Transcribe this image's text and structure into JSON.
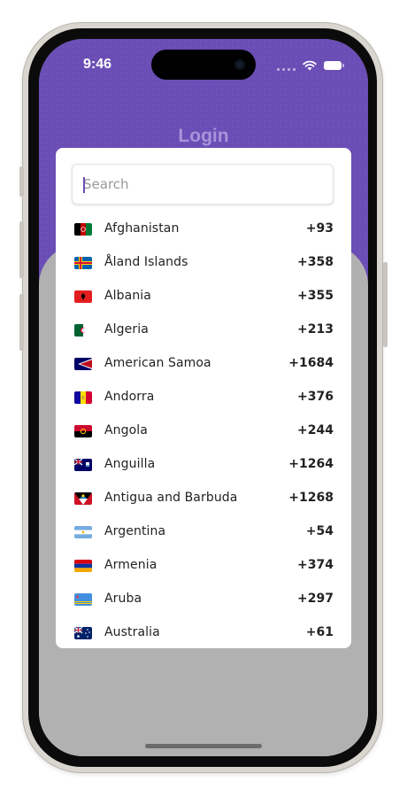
{
  "status_bar": {
    "time": "9:46"
  },
  "header": {
    "title": "Login"
  },
  "picker": {
    "search_placeholder": "Search",
    "countries": [
      {
        "name": "Afghanistan",
        "code": "+93",
        "flag": "afghanistan-flag-icon"
      },
      {
        "name": "Åland Islands",
        "code": "+358",
        "flag": "aland-islands-flag-icon"
      },
      {
        "name": "Albania",
        "code": "+355",
        "flag": "albania-flag-icon"
      },
      {
        "name": "Algeria",
        "code": "+213",
        "flag": "algeria-flag-icon"
      },
      {
        "name": "American Samoa",
        "code": "+1684",
        "flag": "american-samoa-flag-icon"
      },
      {
        "name": "Andorra",
        "code": "+376",
        "flag": "andorra-flag-icon"
      },
      {
        "name": "Angola",
        "code": "+244",
        "flag": "angola-flag-icon"
      },
      {
        "name": "Anguilla",
        "code": "+1264",
        "flag": "anguilla-flag-icon"
      },
      {
        "name": "Antigua and Barbuda",
        "code": "+1268",
        "flag": "antigua-barbuda-flag-icon"
      },
      {
        "name": "Argentina",
        "code": "+54",
        "flag": "argentina-flag-icon"
      },
      {
        "name": "Armenia",
        "code": "+374",
        "flag": "armenia-flag-icon"
      },
      {
        "name": "Aruba",
        "code": "+297",
        "flag": "aruba-flag-icon"
      },
      {
        "name": "Australia",
        "code": "+61",
        "flag": "australia-flag-icon"
      }
    ]
  },
  "colors": {
    "header_purple": "#6a4db5",
    "overlay_gray": "#b1b1b1",
    "title_lilac": "#a795db"
  }
}
